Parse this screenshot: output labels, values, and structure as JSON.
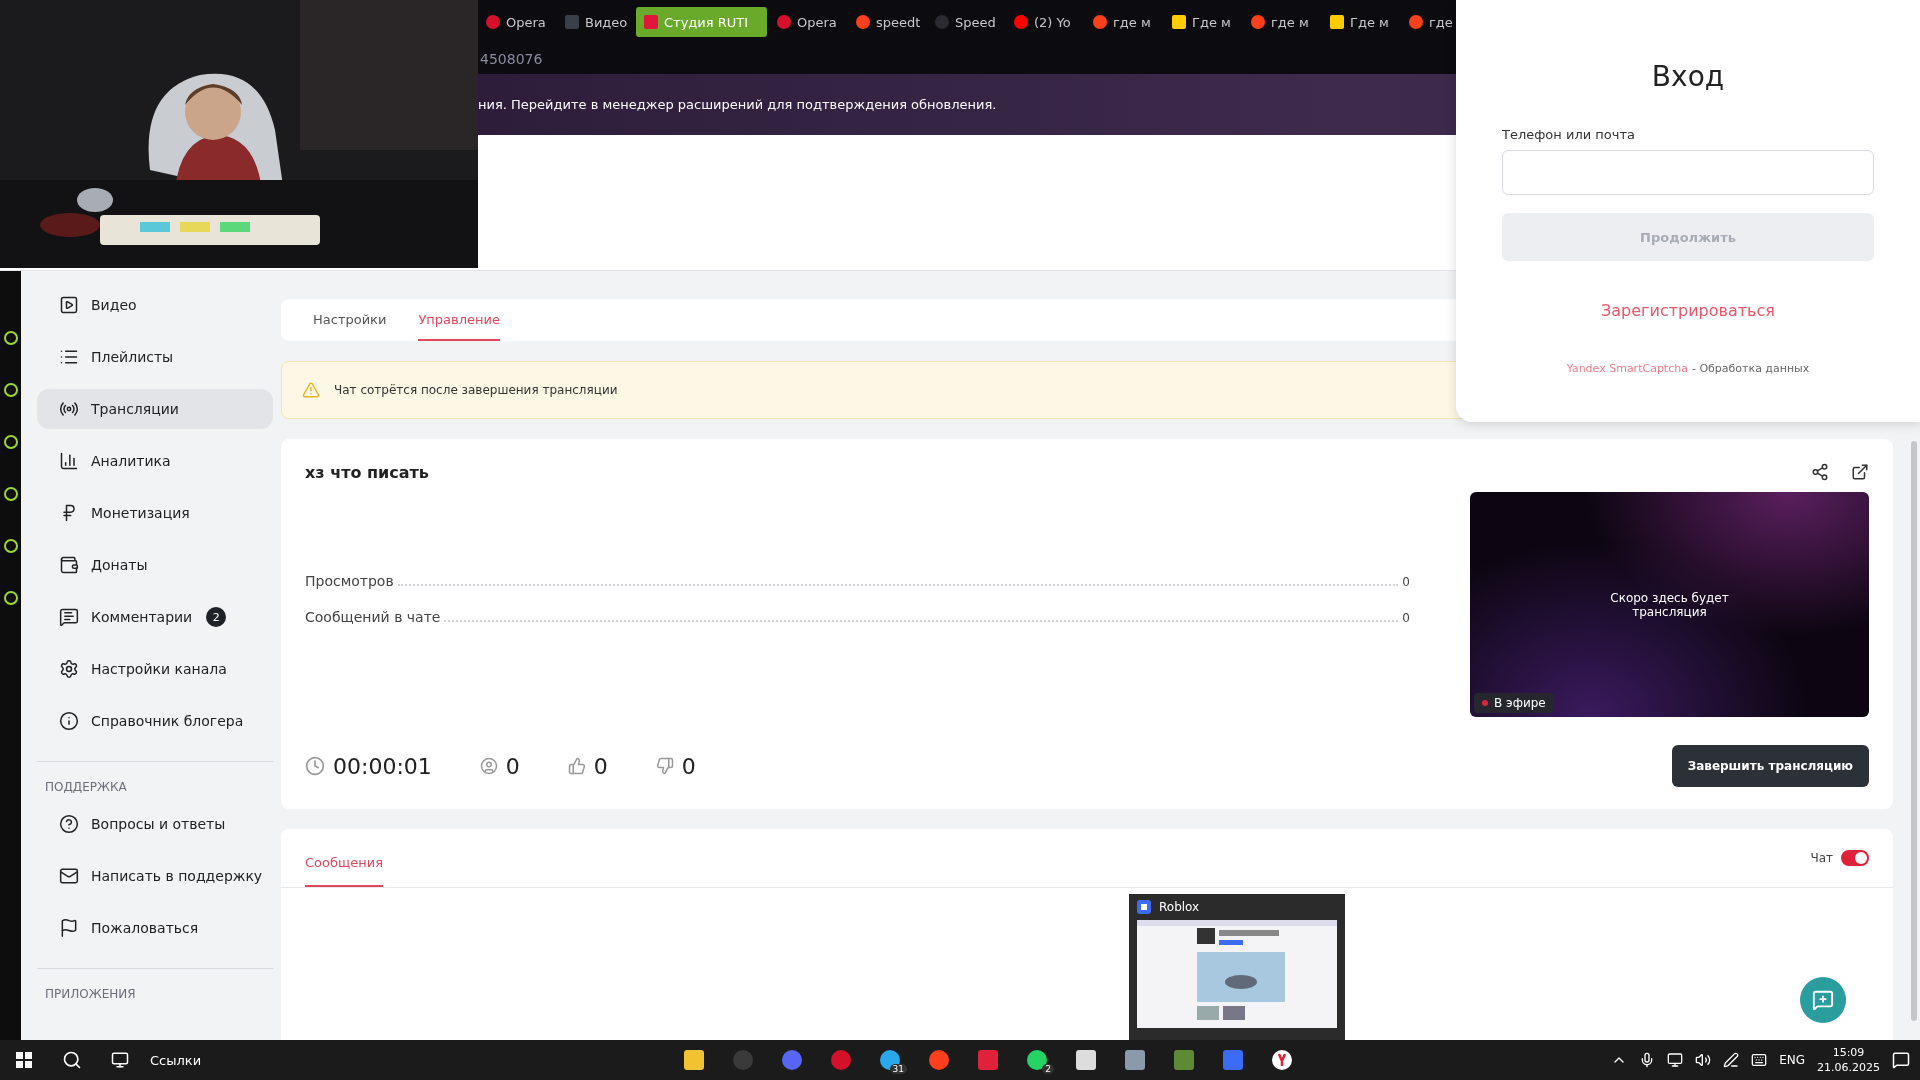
{
  "browser": {
    "tabs": [
      {
        "label": "Opera",
        "kind": "opera",
        "selected": false
      },
      {
        "label": "Видео",
        "kind": "rutube",
        "selected": false
      },
      {
        "label": "Студия RUTI",
        "kind": "studio",
        "selected": true
      },
      {
        "label": "Opera",
        "kind": "opera",
        "selected": false
      },
      {
        "label": "speedt",
        "kind": "yandex",
        "selected": false
      },
      {
        "label": "Speed",
        "kind": "speedtest",
        "selected": false
      },
      {
        "label": "(2) Yo",
        "kind": "youtube",
        "selected": false
      },
      {
        "label": "где м",
        "kind": "yandex",
        "selected": false
      },
      {
        "label": "Где м",
        "kind": "images",
        "selected": false
      },
      {
        "label": "где м",
        "kind": "yandex",
        "selected": false
      },
      {
        "label": "Где м",
        "kind": "images",
        "selected": false
      },
      {
        "label": "где",
        "kind": "yandex",
        "selected": false
      }
    ],
    "address": "4508076",
    "notice": "ния. Перейдите в менеджер расширений для подтверждения обновления."
  },
  "sidebar": {
    "items": [
      {
        "kind": "video",
        "label": "Видео",
        "selected": false
      },
      {
        "kind": "playlists",
        "label": "Плейлисты",
        "selected": false
      },
      {
        "kind": "streams",
        "label": "Трансляции",
        "selected": true
      },
      {
        "kind": "analytics",
        "label": "Аналитика",
        "selected": false
      },
      {
        "kind": "money",
        "label": "Монетизация",
        "selected": false
      },
      {
        "kind": "donations",
        "label": "Донаты",
        "selected": false
      },
      {
        "kind": "comments",
        "label": "Комментарии",
        "selected": false,
        "badge": "2"
      },
      {
        "kind": "settings",
        "label": "Настройки канала",
        "selected": false
      },
      {
        "kind": "info",
        "label": "Справочник блогера",
        "selected": false
      }
    ],
    "sections": [
      {
        "title": "ПОДДЕРЖКА",
        "items": [
          {
            "kind": "help",
            "label": "Вопросы и ответы",
            "selected": false
          },
          {
            "kind": "mail",
            "label": "Написать в поддержку",
            "selected": false
          },
          {
            "kind": "flag",
            "label": "Пожаловаться",
            "selected": false
          }
        ]
      },
      {
        "title": "ПРИЛОЖЕНИЯ"
      }
    ]
  },
  "page_tabs": [
    {
      "label": "Настройки",
      "selected": false
    },
    {
      "label": "Управление",
      "selected": true
    }
  ],
  "warning": "Чат сотрётся после завершения трансляции",
  "broadcast": {
    "title": "хз что писать",
    "stats": [
      {
        "label": "Просмотров",
        "value": "0"
      },
      {
        "label": "Сообщений в чате",
        "value": "0"
      }
    ],
    "preview_text": "Скоро здесь будет трансляция",
    "live_label": "В эфире",
    "duration": "00:00:01",
    "viewers": "0",
    "likes": "0",
    "dislikes": "0",
    "end_button": "Завершить трансляцию"
  },
  "messages": {
    "tabs": [
      {
        "label": "Сообщения",
        "selected": true
      }
    ],
    "chat_toggle": {
      "label": "Чат",
      "on": true
    }
  },
  "login": {
    "title": "Вход",
    "field_label": "Телефон или почта",
    "continue_button": {
      "label": "Продолжить",
      "disabled": true
    },
    "register_link": "Зарегистрироваться",
    "captcha_link": "Yandex SmartCaptcha",
    "captcha_text": "- Обработка данных"
  },
  "window_preview": {
    "title": "Roblox"
  },
  "taskbar": {
    "links_label": "Ссылки",
    "apps": [
      {
        "kind": "files"
      },
      {
        "kind": "obs"
      },
      {
        "kind": "discord"
      },
      {
        "kind": "opera"
      },
      {
        "kind": "telegram",
        "badge": "31"
      },
      {
        "kind": "yandex"
      },
      {
        "kind": "recorder"
      },
      {
        "kind": "whatsapp",
        "badge": "2"
      },
      {
        "kind": "studio"
      },
      {
        "kind": "monitor"
      },
      {
        "kind": "minecraft"
      },
      {
        "kind": "roblox"
      },
      {
        "kind": "ybrowser"
      }
    ],
    "lang": "ENG",
    "time": "15:09",
    "date": "21.06.2025"
  }
}
